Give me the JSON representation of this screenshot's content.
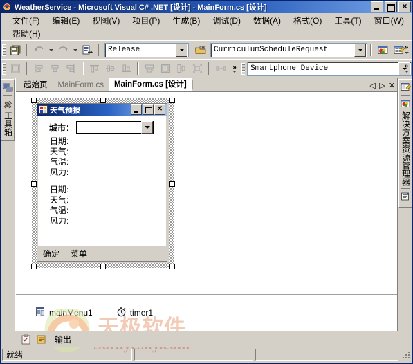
{
  "window": {
    "title": "WeatherService - Microsoft Visual C# .NET [设计] - MainForm.cs [设计]",
    "icon": "visual-studio-icon",
    "buttons": {
      "minimize": "_",
      "maximize": "□",
      "close": "✕"
    }
  },
  "menubar": {
    "row1": [
      {
        "label": "文件(F)"
      },
      {
        "label": "编辑(E)"
      },
      {
        "label": "视图(V)"
      },
      {
        "label": "项目(P)"
      },
      {
        "label": "生成(B)"
      },
      {
        "label": "调试(D)"
      },
      {
        "label": "数据(A)"
      },
      {
        "label": "格式(O)"
      },
      {
        "label": "工具(T)"
      },
      {
        "label": "窗口(W)"
      }
    ],
    "row2": [
      {
        "label": "帮助(H)"
      }
    ]
  },
  "toolbar1": {
    "save_all_icon": "save-all-icon",
    "undo_icon": "undo-icon",
    "redo_icon": "redo-icon",
    "navigate_icon": "navigate-icon",
    "configuration": {
      "value": "Release",
      "placeholder": "Release"
    },
    "start_icon": "start-debug-icon",
    "project": {
      "value": "CurriculumScheduleRequest",
      "placeholder": "CurriculumScheduleRequest"
    },
    "solution_explorer_icon": "solution-explorer-icon",
    "properties_icon": "properties-window-icon",
    "overflow": "»"
  },
  "toolbar2": {
    "icons": [
      "bring-to-front-icon",
      "align-lefts-icon",
      "align-centers-icon",
      "align-rights-icon",
      "align-tops-icon",
      "align-middles-icon",
      "align-bottoms-icon",
      "make-same-width-icon",
      "make-same-size-icon",
      "make-same-height-icon",
      "size-to-grid-icon",
      "horizontal-spacing-icon"
    ],
    "device": {
      "value": "Smartphone Device",
      "placeholder": "Smartphone Device"
    },
    "overflow": "»"
  },
  "left_dock": {
    "server_explorer_icon": "server-explorer-icon",
    "toolbox_icon": "toolbox-icon",
    "label": "工具箱"
  },
  "right_dock": {
    "properties_icon": "properties-icon",
    "solution_icon": "solution-explorer-icon",
    "label": "解决方案资源管理器",
    "class_view_icon": "class-view-icon"
  },
  "document_tabs": {
    "tabs": [
      {
        "label": "起始页",
        "active": false
      },
      {
        "label": "MainForm.cs",
        "active": false
      },
      {
        "label": "MainForm.cs [设计]",
        "active": true
      }
    ],
    "nav": {
      "prev": "◁",
      "next": "▷",
      "close": "✕"
    }
  },
  "designer": {
    "form": {
      "title": "天气预报",
      "icon": "form-icon",
      "buttons": {
        "minimize": "_",
        "maximize": "□",
        "close": "✕"
      },
      "city_label": "城市：",
      "city_combo": {
        "value": "",
        "placeholder": ""
      },
      "group1": [
        "日期:",
        "天气:",
        "气温:",
        "风力:"
      ],
      "group2": [
        "日期:",
        "天气:",
        "气温:",
        "风力:"
      ],
      "menu": [
        "确定",
        "菜单"
      ]
    },
    "tray": [
      {
        "label": "mainMenu1",
        "icon": "main-menu-component-icon"
      },
      {
        "label": "timer1",
        "icon": "timer-component-icon"
      }
    ]
  },
  "watermark": {
    "chinese": "天极软件",
    "english": "Soft.yesky.com"
  },
  "output_strip": {
    "task_list_icon": "task-list-icon",
    "output_icon": "output-window-icon",
    "label": "输出"
  },
  "statusbar": {
    "ready": "就绪",
    "pane2": "",
    "pane3": ""
  },
  "colors": {
    "title_start": "#0a246a",
    "title_end": "#7aa7e8",
    "face": "#d4d0c8",
    "watermark_cn": "#e8a07a",
    "watermark_en": "#c9785a"
  }
}
